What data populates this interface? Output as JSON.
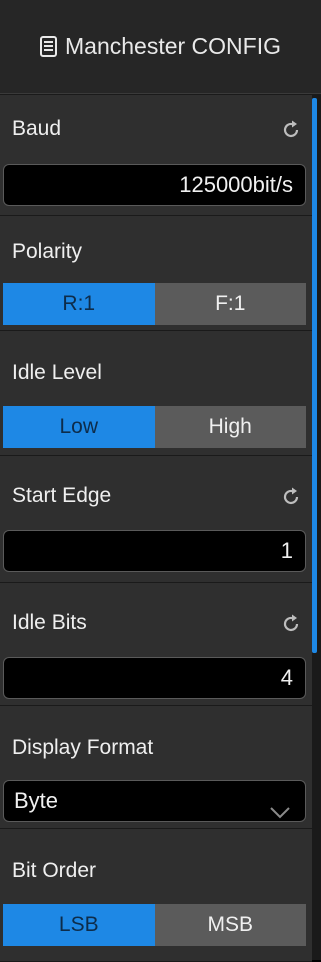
{
  "header": {
    "icon": "document-list-icon",
    "title": "Manchester CONFIG"
  },
  "baud": {
    "label": "Baud",
    "value": "125000bit/s",
    "icon": "reset-icon"
  },
  "polarity": {
    "label": "Polarity",
    "options": [
      "R:1",
      "F:1"
    ],
    "selected": "R:1"
  },
  "idle_level": {
    "label": "Idle Level",
    "options": [
      "Low",
      "High"
    ],
    "selected": "Low"
  },
  "start_edge": {
    "label": "Start Edge",
    "value": "1",
    "icon": "reset-icon"
  },
  "idle_bits": {
    "label": "Idle Bits",
    "value": "4",
    "icon": "reset-icon"
  },
  "display_format": {
    "label": "Display Format",
    "value": "Byte",
    "icon": "chevron-down-icon"
  },
  "bit_order": {
    "label": "Bit Order",
    "options": [
      "LSB",
      "MSB"
    ],
    "selected": "LSB"
  },
  "colors": {
    "accent": "#1e88e5",
    "segment_off": "#5b5b5b",
    "section_bg": "#2f2f2f"
  }
}
